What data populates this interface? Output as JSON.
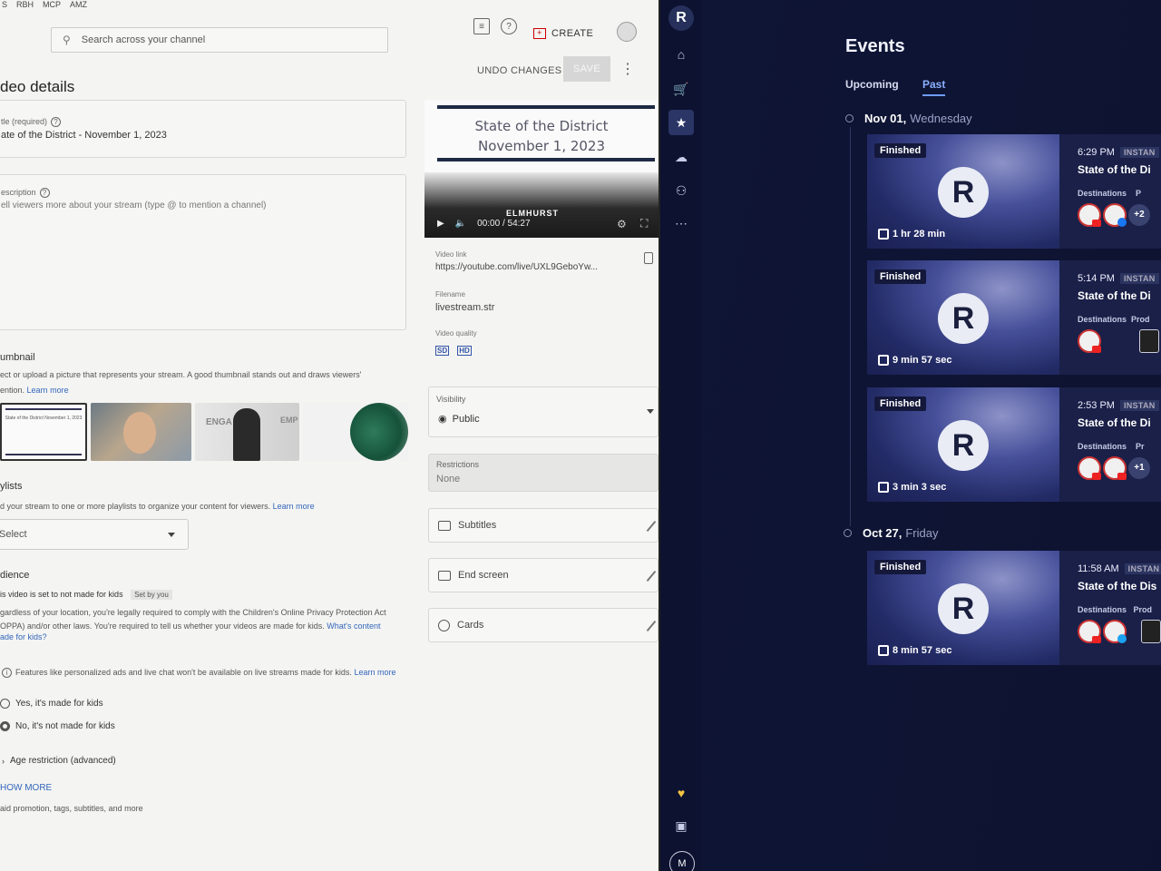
{
  "bookmarks": [
    "S",
    "RBH",
    "MCP",
    "AMZ"
  ],
  "youtube": {
    "search_placeholder": "Search across your channel",
    "create_label": "CREATE",
    "page_heading": "deo details",
    "undo_label": "UNDO CHANGES",
    "save_label": "SAVE",
    "title_field": {
      "label": "tle (required)",
      "value": "ate of the District - November 1, 2023"
    },
    "description_field": {
      "label": "escription",
      "placeholder": "ell viewers more about your stream (type @ to mention a channel)"
    },
    "thumbnail": {
      "title": "umbnail",
      "text": "ect or upload a picture that represents your stream. A good thumbnail stands out and draws viewers'",
      "text2": "ention.",
      "learn_more": "Learn more",
      "thumb1_text": "State of the District November 1, 2023",
      "thumb3_word1": "ENGA",
      "thumb3_word2": "EMP"
    },
    "playlists": {
      "title": "ylists",
      "text": "d your stream to one or more playlists to organize your content for viewers.",
      "learn_more": "Learn more",
      "select_value": "Select"
    },
    "audience": {
      "title": "dience",
      "set_text": "is video is set to not made for kids",
      "set_by": "Set by you",
      "line1": "gardless of your location, you're legally required to comply with the Children's Online Privacy Protection Act",
      "line2": "OPPA) and/or other laws. You're required to tell us whether your videos are made for kids.",
      "whats_content": "What's content",
      "line3": "ade for kids?",
      "note": "Features like personalized ads and live chat won't be available on live streams made for kids.",
      "note_link": "Learn more",
      "option_yes": "Yes, it's made for kids",
      "option_no": "No, it's not made for kids",
      "age_restriction": "Age restriction (advanced)"
    },
    "show_more": "HOW MORE",
    "show_more_sub": "aid promotion, tags, subtitles, and more",
    "preview": {
      "title_line1": "State of the District",
      "title_line2": "November 1, 2023",
      "logo_text": "ELMHURST",
      "time": "00:00 / 54:27"
    },
    "video_link": {
      "label": "Video link",
      "value": "https://youtube.com/live/UXL9GeboYw..."
    },
    "filename": {
      "label": "Filename",
      "value": "livestream.str"
    },
    "video_quality": {
      "label": "Video quality",
      "badges": [
        "SD",
        "HD"
      ]
    },
    "visibility": {
      "label": "Visibility",
      "value": "Public"
    },
    "restrictions": {
      "label": "Restrictions",
      "value": "None"
    },
    "side_rows": [
      "Subtitles",
      "End screen",
      "Cards"
    ]
  },
  "rail": {
    "logo": "R",
    "icons": [
      "home-icon",
      "cart-icon",
      "calendar-star-icon",
      "cloud-icon",
      "people-icon",
      "more-icon",
      "heart-icon",
      "gift-icon"
    ],
    "avatar": "M"
  },
  "restream": {
    "title": "Events",
    "tabs": [
      "Upcoming",
      "Past"
    ],
    "groups": [
      {
        "date_bold": "Nov 01,",
        "date_day": "Wednesday",
        "events": [
          {
            "status": "Finished",
            "letter": "R",
            "duration": "1 hr 28 min",
            "time": "6:29 PM",
            "type": "INSTAN",
            "title": "State of the Di",
            "dest_label": "Destinations",
            "dest_label2": "P",
            "extra": "+2"
          },
          {
            "status": "Finished",
            "letter": "R",
            "duration": "9 min 57 sec",
            "time": "5:14 PM",
            "type": "INSTAN",
            "title": "State of the Di",
            "dest_label": "Destinations",
            "dest_label2": "Prod",
            "extra": ""
          },
          {
            "status": "Finished",
            "letter": "R",
            "duration": "3 min 3 sec",
            "time": "2:53 PM",
            "type": "INSTAN",
            "title": "State of the Di",
            "dest_label": "Destinations",
            "dest_label2": "Pr",
            "extra": "+1"
          }
        ]
      },
      {
        "date_bold": "Oct 27,",
        "date_day": "Friday",
        "events": [
          {
            "status": "Finished",
            "letter": "R",
            "duration": "8 min 57 sec",
            "time": "11:58 AM",
            "type": "INSTAN",
            "title": "State of the Dis",
            "dest_label": "Destinations",
            "dest_label2": "Prod",
            "extra": ""
          }
        ]
      }
    ]
  }
}
